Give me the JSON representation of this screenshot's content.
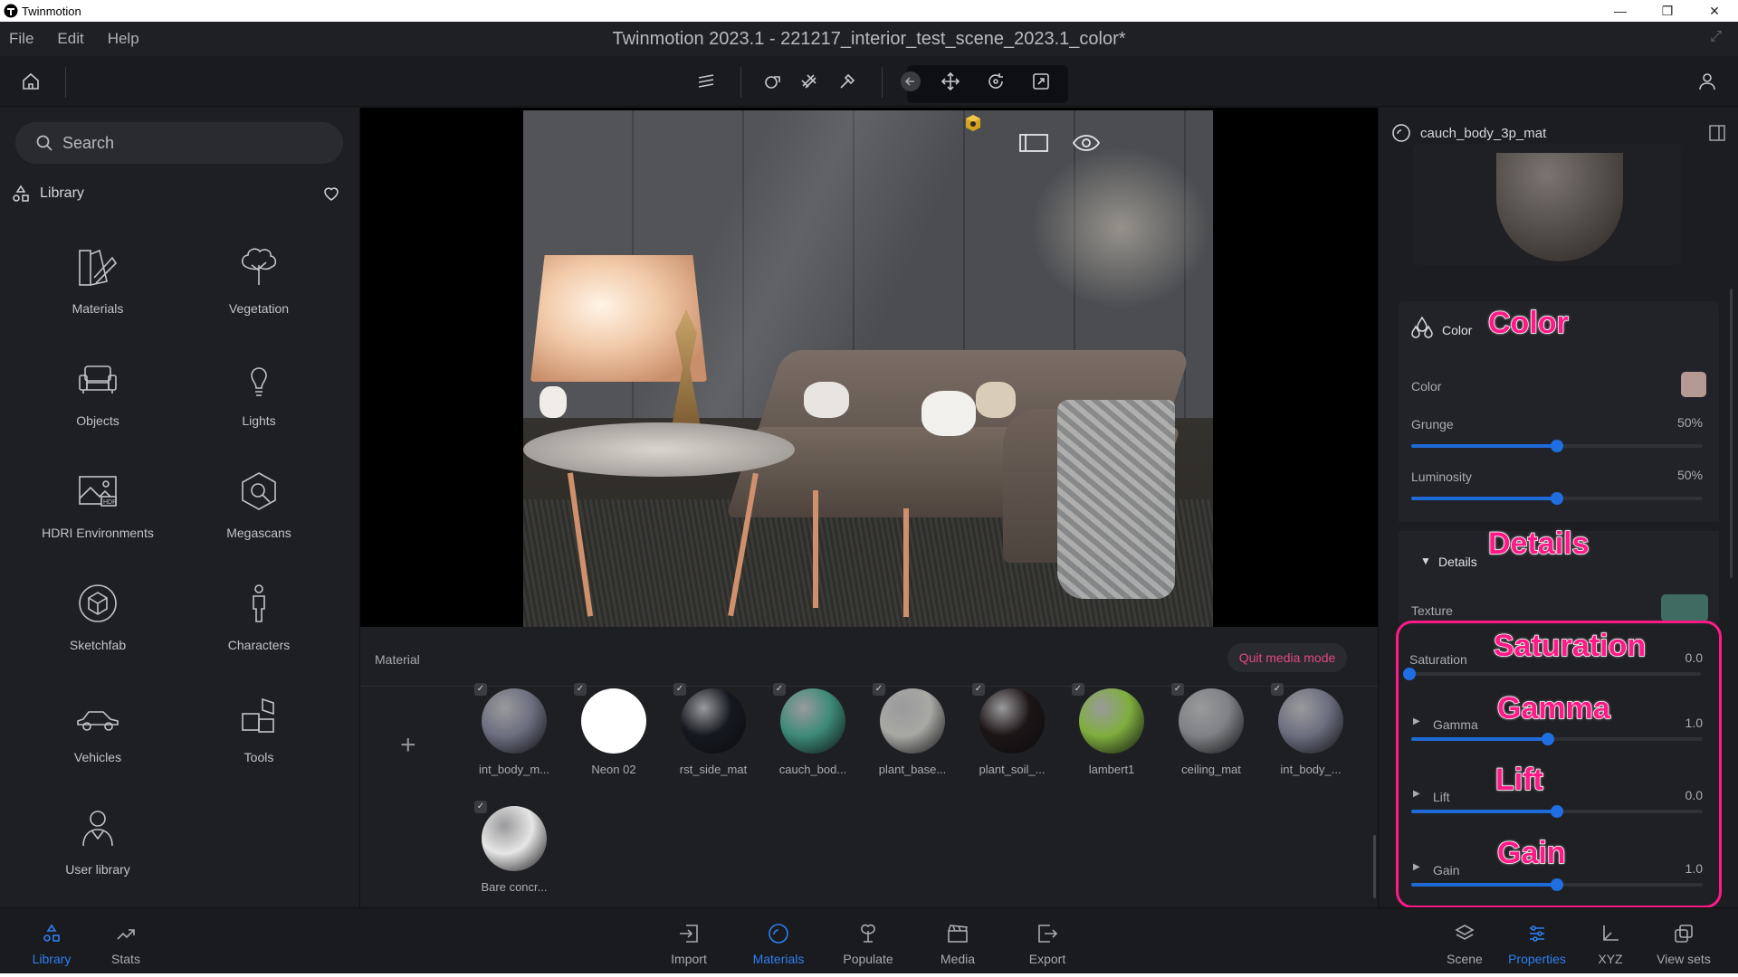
{
  "app": {
    "name": "Twinmotion",
    "doc_title": "Twinmotion 2023.1 - 221217_interior_test_scene_2023.1_color*"
  },
  "menu": [
    "File",
    "Edit",
    "Help"
  ],
  "search": {
    "placeholder": "Search"
  },
  "library": {
    "title": "Library",
    "categories": [
      "Materials",
      "Vegetation",
      "Objects",
      "Lights",
      "HDRI Environments",
      "Megascans",
      "Sketchfab",
      "Characters",
      "Vehicles",
      "Tools",
      "User library"
    ]
  },
  "material_panel": {
    "label": "Material",
    "quit_label": "Quit media mode",
    "items": [
      {
        "name": "int_body_m...",
        "color": "#6d6f80"
      },
      {
        "name": "Neon 02",
        "color": "#ffffff"
      },
      {
        "name": "rst_side_mat",
        "color": "#151820"
      },
      {
        "name": "cauch_bod...",
        "color": "#3d8b7a"
      },
      {
        "name": "plant_base...",
        "color": "#a8a8a4"
      },
      {
        "name": "plant_soil_...",
        "color": "#1c1516"
      },
      {
        "name": "lambert1",
        "color": "#7fae3e"
      },
      {
        "name": "ceiling_mat",
        "color": "#7f8184"
      },
      {
        "name": "int_body_...",
        "color": "#6d6f80"
      },
      {
        "name": "Bare concr...",
        "color": "#e6e6e6"
      }
    ]
  },
  "properties": {
    "material_name": "cauch_body_3p_mat",
    "color_section": {
      "title": "Color",
      "color_label": "Color",
      "color_swatch": "#b49a92",
      "grunge_label": "Grunge",
      "grunge_value": "50%",
      "grunge_level": 0.5,
      "luminosity_label": "Luminosity",
      "luminosity_value": "50%",
      "luminosity_level": 0.5
    },
    "details_section": {
      "title": "Details",
      "texture_label": "Texture",
      "texture_swatch": "#3f6b62",
      "saturation_label": "Saturation",
      "saturation_value": "0.0",
      "saturation_level": 0.0,
      "gamma_label": "Gamma",
      "gamma_value": "1.0",
      "gamma_level": 0.47,
      "lift_label": "Lift",
      "lift_value": "0.0",
      "lift_level": 0.5,
      "gain_label": "Gain",
      "gain_value": "1.0",
      "gain_level": 0.5
    }
  },
  "callouts": {
    "color": "Color",
    "details": "Details",
    "saturation": "Saturation",
    "gamma": "Gamma",
    "lift": "Lift",
    "gain": "Gain"
  },
  "bottom_nav": {
    "left": [
      {
        "label": "Library",
        "active": true
      },
      {
        "label": "Stats",
        "active": false
      }
    ],
    "center": [
      {
        "label": "Import"
      },
      {
        "label": "Materials"
      },
      {
        "label": "Populate"
      },
      {
        "label": "Media"
      },
      {
        "label": "Export"
      }
    ],
    "right": [
      {
        "label": "Scene"
      },
      {
        "label": "Properties"
      },
      {
        "label": "XYZ"
      },
      {
        "label": "View sets"
      }
    ]
  },
  "colors": {
    "accent": "#2e7ff0",
    "highlight": "#ff1a88"
  }
}
